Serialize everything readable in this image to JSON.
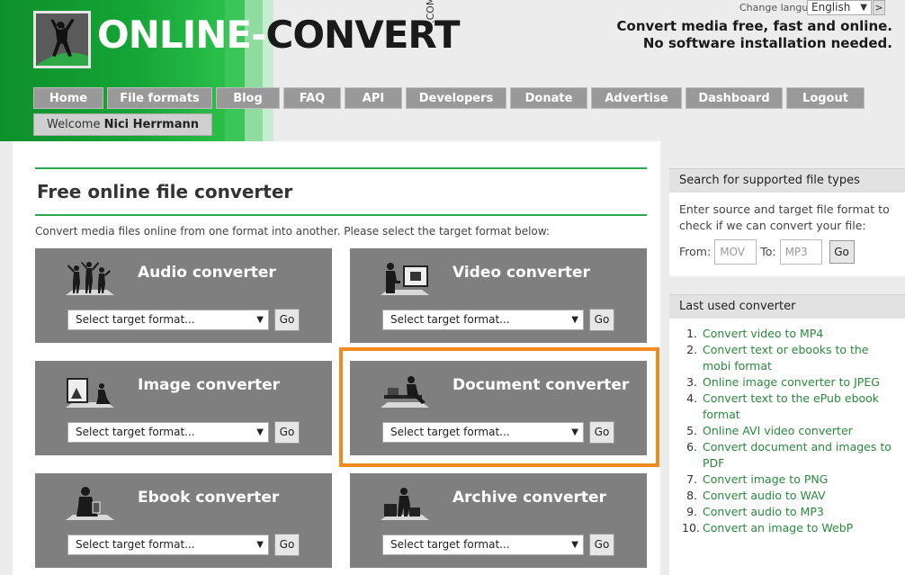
{
  "header": {
    "logo_text_part1": "ONLINE-",
    "logo_text_part2": "CONVERT",
    "logo_suffix": ".COM",
    "change_language_label": "Change language:",
    "language_selected": "English",
    "language_go": ">",
    "tagline_line1": "Convert media free, fast and online.",
    "tagline_line2": "No software installation needed."
  },
  "nav": {
    "items": [
      {
        "label": "Home"
      },
      {
        "label": "File formats"
      },
      {
        "label": "Blog"
      },
      {
        "label": "FAQ"
      },
      {
        "label": "API"
      },
      {
        "label": "Developers"
      },
      {
        "label": "Donate"
      },
      {
        "label": "Advertise"
      },
      {
        "label": "Dashboard"
      },
      {
        "label": "Logout"
      }
    ],
    "welcome_prefix": "Welcome",
    "welcome_name": "Nici Herrmann"
  },
  "main": {
    "title": "Free online file converter",
    "intro": "Convert media files online from one format into another. Please select the target format below:",
    "select_placeholder": "Select target format...",
    "go_label": "Go",
    "cards": [
      {
        "title": "Audio converter",
        "icon": "audio-people-icon"
      },
      {
        "title": "Video converter",
        "icon": "video-icon"
      },
      {
        "title": "Image converter",
        "icon": "image-icon"
      },
      {
        "title": "Document converter",
        "icon": "document-icon"
      },
      {
        "title": "Ebook converter",
        "icon": "ebook-icon"
      },
      {
        "title": "Archive converter",
        "icon": "archive-icon"
      }
    ]
  },
  "sidebar": {
    "search": {
      "heading": "Search for supported file types",
      "text": "Enter source and target file format to check if we can convert your file:",
      "from_label": "From:",
      "from_placeholder": "MOV",
      "to_label": "To:",
      "to_placeholder": "MP3",
      "go_label": "Go"
    },
    "last_used": {
      "heading": "Last used converter",
      "items": [
        {
          "num": "1.",
          "label": "Convert video to MP4"
        },
        {
          "num": "2.",
          "label": "Convert text or ebooks to the mobi format"
        },
        {
          "num": "3.",
          "label": "Online image converter to JPEG"
        },
        {
          "num": "4.",
          "label": "Convert text to the ePub ebook format"
        },
        {
          "num": "5.",
          "label": "Online AVI video converter"
        },
        {
          "num": "6.",
          "label": "Convert document and images to PDF"
        },
        {
          "num": "7.",
          "label": "Convert image to PNG"
        },
        {
          "num": "8.",
          "label": "Convert audio to WAV"
        },
        {
          "num": "9.",
          "label": "Convert audio to MP3"
        },
        {
          "num": "10.",
          "label": "Convert an image to WebP"
        }
      ]
    }
  },
  "colors": {
    "brand_green": "#15a536",
    "card_grey": "#7f7f7f",
    "highlight_orange": "#f28a1f",
    "link_green": "#2a8a3c"
  }
}
